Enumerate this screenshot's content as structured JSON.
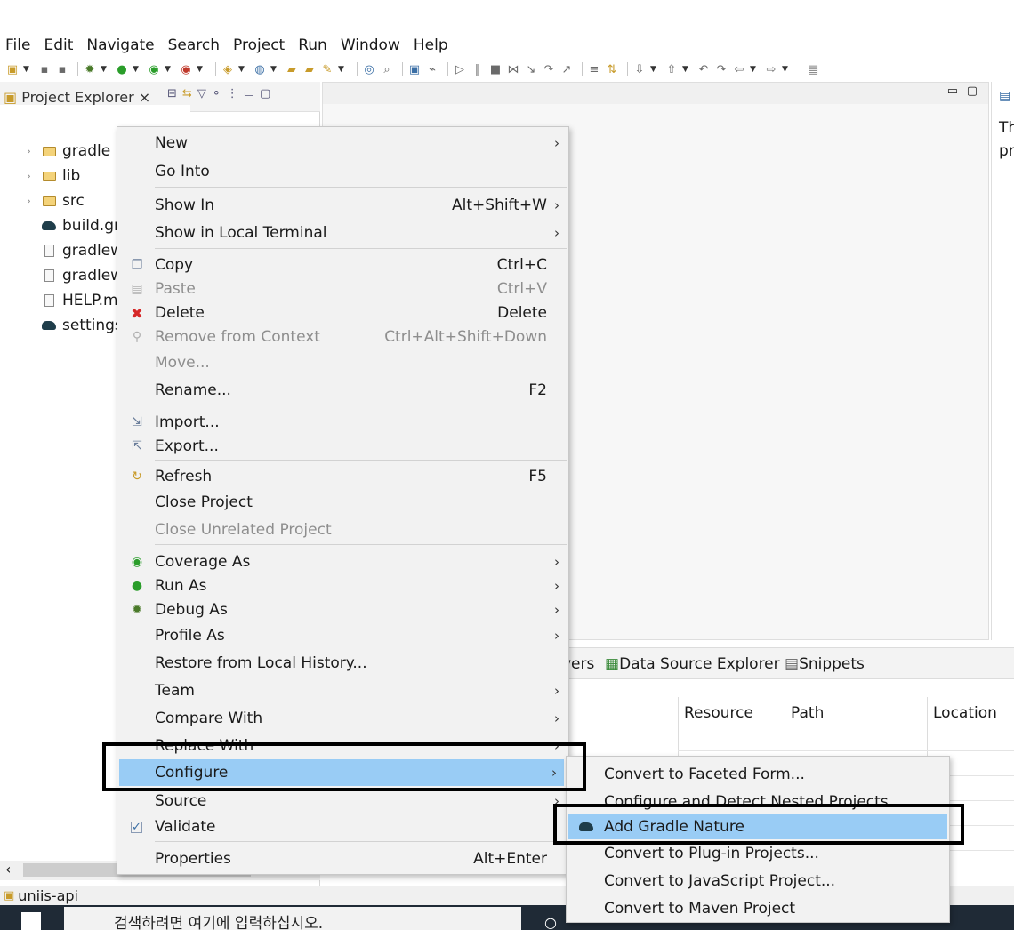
{
  "menubar": [
    "File",
    "Edit",
    "Navigate",
    "Search",
    "Project",
    "Run",
    "Window",
    "Help"
  ],
  "explorer": {
    "tab_label": "Project Explorer",
    "tree": [
      {
        "label": "gradle",
        "kind": "folder",
        "expandable": true
      },
      {
        "label": "lib",
        "kind": "folder",
        "expandable": true
      },
      {
        "label": "src",
        "kind": "folder",
        "expandable": true
      },
      {
        "label": "build.gr",
        "kind": "gradle",
        "expandable": false
      },
      {
        "label": "gradlew",
        "kind": "file",
        "expandable": false
      },
      {
        "label": "gradlew",
        "kind": "file",
        "expandable": false
      },
      {
        "label": "HELP.m",
        "kind": "file",
        "expandable": false
      },
      {
        "label": "settings",
        "kind": "gradle",
        "expandable": false
      }
    ]
  },
  "right_panel": {
    "line1": "Th",
    "line2": "pr"
  },
  "bottom_panel": {
    "tabs": [
      "vers",
      "Data Source Explorer",
      "Snippets"
    ],
    "columns": [
      "Resource",
      "Path",
      "Location"
    ]
  },
  "statusbar": {
    "project": "uniis-api"
  },
  "taskbar": {
    "search_placeholder": "검색하려면 여기에 입력하십시오."
  },
  "context_menu": {
    "items": [
      {
        "label": "New",
        "has_submenu": true
      },
      {
        "label": "Go Into"
      },
      {
        "label": "Show In",
        "shortcut": "Alt+Shift+W",
        "has_submenu": true
      },
      {
        "label": "Show in Local Terminal",
        "has_submenu": true
      },
      {
        "label": "Copy",
        "shortcut": "Ctrl+C",
        "icon": "copy-icon"
      },
      {
        "label": "Paste",
        "shortcut": "Ctrl+V",
        "icon": "paste-icon",
        "disabled": true
      },
      {
        "label": "Delete",
        "shortcut": "Delete",
        "icon": "delete-icon"
      },
      {
        "label": "Remove from Context",
        "shortcut": "Ctrl+Alt+Shift+Down",
        "icon": "remove-context-icon",
        "disabled": true
      },
      {
        "label": "Move...",
        "disabled": true
      },
      {
        "label": "Rename...",
        "shortcut": "F2"
      },
      {
        "label": "Import...",
        "icon": "import-icon"
      },
      {
        "label": "Export...",
        "icon": "export-icon"
      },
      {
        "label": "Refresh",
        "shortcut": "F5",
        "icon": "refresh-icon"
      },
      {
        "label": "Close Project"
      },
      {
        "label": "Close Unrelated Project",
        "disabled": true
      },
      {
        "label": "Coverage As",
        "has_submenu": true,
        "icon": "coverage-icon"
      },
      {
        "label": "Run As",
        "has_submenu": true,
        "icon": "run-icon"
      },
      {
        "label": "Debug As",
        "has_submenu": true,
        "icon": "debug-icon"
      },
      {
        "label": "Profile As",
        "has_submenu": true
      },
      {
        "label": "Restore from Local History..."
      },
      {
        "label": "Team",
        "has_submenu": true
      },
      {
        "label": "Compare With",
        "has_submenu": true
      },
      {
        "label": "Replace With",
        "has_submenu": true
      },
      {
        "label": "Configure",
        "has_submenu": true,
        "selected": true
      },
      {
        "label": "Source",
        "has_submenu": true
      },
      {
        "label": "Validate",
        "icon": "checkbox-icon"
      },
      {
        "label": "Properties",
        "shortcut": "Alt+Enter"
      }
    ]
  },
  "configure_submenu": {
    "items": [
      {
        "label": "Convert to Faceted Form..."
      },
      {
        "label": "Configure and Detect Nested Projects..."
      },
      {
        "label": "Add Gradle Nature",
        "selected": true,
        "icon": "gradle-icon"
      },
      {
        "label": "Convert to Plug-in Projects..."
      },
      {
        "label": "Convert to JavaScript Project..."
      },
      {
        "label": "Convert to Maven Project"
      }
    ]
  },
  "colors": {
    "menu_bg": "#f2f2f2",
    "selection": "#99ccf5",
    "highlight_box": "#000000",
    "delete_red": "#d62828"
  }
}
